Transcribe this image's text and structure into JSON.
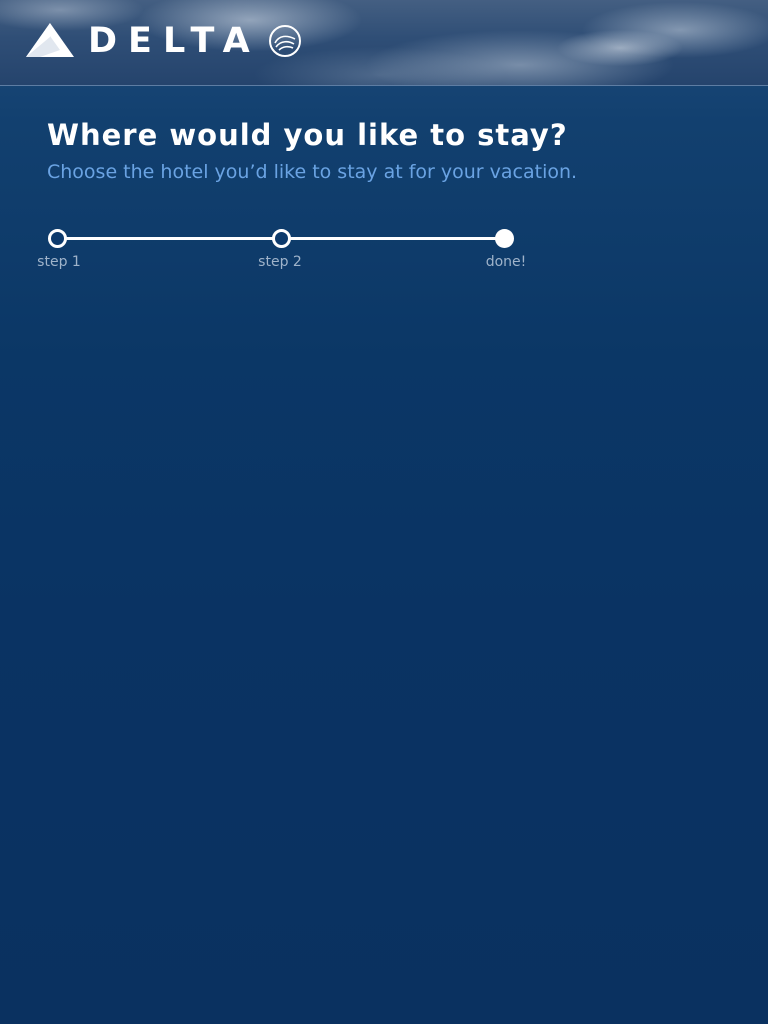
{
  "header": {
    "brand_name": "DELTA",
    "alliance_logo": "SKYTEAM",
    "brand_icon": "delta-widget-icon",
    "alliance_icon": "skyteam-swirl-icon"
  },
  "page": {
    "title": "Where would you like to stay?",
    "subtitle": "Choose the hotel you’d like to stay at for your vacation."
  },
  "progress": {
    "steps": [
      {
        "label": "step 1",
        "state": "open"
      },
      {
        "label": "step 2",
        "state": "open"
      },
      {
        "label": "done!",
        "state": "filled"
      }
    ]
  },
  "colors": {
    "background": "#0a3363",
    "title": "#ffffff",
    "subtitle": "#6aa3e3",
    "step_label": "#9fb3ca",
    "track": "#ffffff"
  }
}
